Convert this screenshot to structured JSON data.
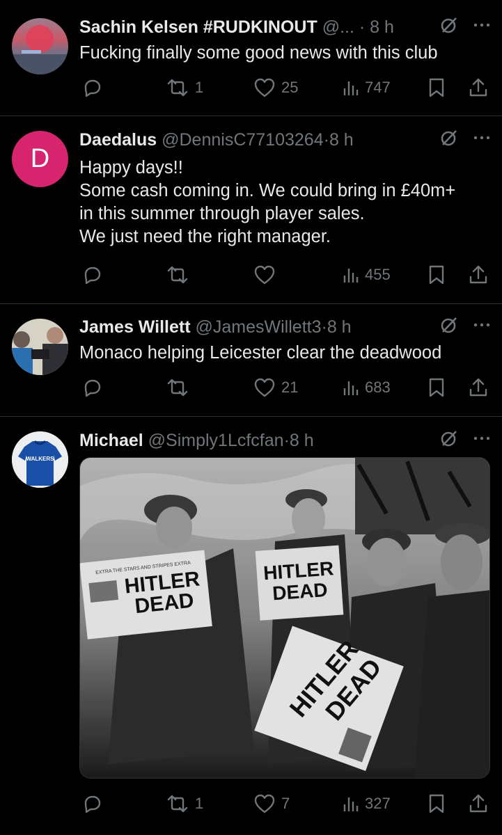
{
  "tweets": [
    {
      "name": "Sachin Kelsen #RUDKINOUT",
      "handle": "@...",
      "time": "8 h",
      "text": [
        "Fucking finally some good news with this club"
      ],
      "avatar": {
        "type": "image",
        "icon": "avatar-sunset"
      },
      "stats": {
        "replies": "",
        "reposts": "1",
        "likes": "25",
        "views": "747"
      }
    },
    {
      "name": "Daedalus",
      "handle": "@DennisC77103264",
      "time": "8 h",
      "text": [
        "Happy days!!",
        "Some cash coming in. We could bring in £40m+",
        "in this summer through player sales.",
        "We just need the right manager."
      ],
      "avatar": {
        "type": "letter",
        "letter": "D",
        "color": "#d6246e"
      },
      "stats": {
        "replies": "",
        "reposts": "",
        "likes": "",
        "views": "455"
      }
    },
    {
      "name": "James Willett",
      "handle": "@JamesWillett3",
      "time": "8 h",
      "text": [
        "Monaco helping Leicester clear the deadwood"
      ],
      "avatar": {
        "type": "image",
        "icon": "avatar-people"
      },
      "stats": {
        "replies": "",
        "reposts": "",
        "likes": "21",
        "views": "683"
      }
    },
    {
      "name": "Michael",
      "handle": "@Simply1Lcfcfan",
      "time": "8 h",
      "text": [],
      "avatar": {
        "type": "image",
        "icon": "avatar-leicester-shirt",
        "shirt_text": "WALKERS"
      },
      "stats": {
        "replies": "",
        "reposts": "1",
        "likes": "7",
        "views": "327"
      },
      "image": {
        "description_icon": "photo-soldiers-reading-newspapers",
        "headline_line1": "HITLER",
        "headline_line2": "DEAD",
        "masthead": "EXTRA THE STARS AND STRIPES EXTRA"
      }
    }
  ],
  "colors": {
    "background": "#000000",
    "text": "#e7e9ea",
    "muted": "#71767b",
    "divider": "#2f3336"
  }
}
